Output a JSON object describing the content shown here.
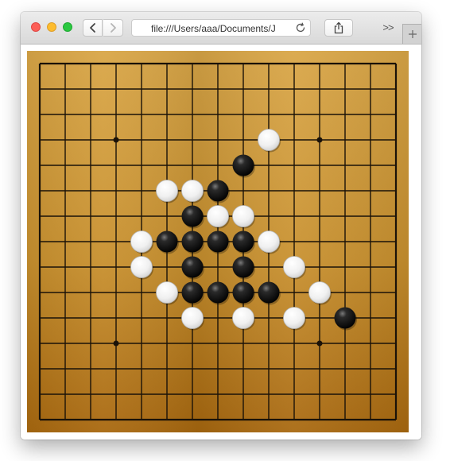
{
  "browser": {
    "address_text": "file:///Users/aaa/Documents/J",
    "overflow_label": ">>",
    "icons": {
      "back": "chevron-left-icon",
      "forward": "chevron-right-icon",
      "reload": "reload-icon",
      "share": "share-icon",
      "new_tab": "plus-icon"
    }
  },
  "game": {
    "type": "gomoku",
    "board_size": 15,
    "star_points": [
      [
        3,
        3
      ],
      [
        11,
        3
      ],
      [
        3,
        11
      ],
      [
        11,
        11
      ]
    ],
    "colors": {
      "board_light": "#d9a647",
      "board_dark": "#a8680f",
      "grid_line": "#1a1208",
      "black_stone": "#0a0a0a",
      "white_stone": "#f2f2f2"
    },
    "stones": [
      {
        "col": 9,
        "row": 3,
        "color": "white"
      },
      {
        "col": 8,
        "row": 4,
        "color": "black"
      },
      {
        "col": 5,
        "row": 5,
        "color": "white"
      },
      {
        "col": 6,
        "row": 5,
        "color": "white"
      },
      {
        "col": 7,
        "row": 5,
        "color": "black"
      },
      {
        "col": 6,
        "row": 6,
        "color": "black"
      },
      {
        "col": 7,
        "row": 6,
        "color": "white"
      },
      {
        "col": 8,
        "row": 6,
        "color": "white"
      },
      {
        "col": 4,
        "row": 7,
        "color": "white"
      },
      {
        "col": 5,
        "row": 7,
        "color": "black"
      },
      {
        "col": 6,
        "row": 7,
        "color": "black"
      },
      {
        "col": 7,
        "row": 7,
        "color": "black"
      },
      {
        "col": 8,
        "row": 7,
        "color": "black"
      },
      {
        "col": 9,
        "row": 7,
        "color": "white"
      },
      {
        "col": 4,
        "row": 8,
        "color": "white"
      },
      {
        "col": 6,
        "row": 8,
        "color": "black"
      },
      {
        "col": 8,
        "row": 8,
        "color": "black"
      },
      {
        "col": 10,
        "row": 8,
        "color": "white"
      },
      {
        "col": 5,
        "row": 9,
        "color": "white"
      },
      {
        "col": 6,
        "row": 9,
        "color": "black"
      },
      {
        "col": 7,
        "row": 9,
        "color": "black"
      },
      {
        "col": 8,
        "row": 9,
        "color": "black"
      },
      {
        "col": 9,
        "row": 9,
        "color": "black"
      },
      {
        "col": 11,
        "row": 9,
        "color": "white"
      },
      {
        "col": 6,
        "row": 10,
        "color": "white"
      },
      {
        "col": 8,
        "row": 10,
        "color": "white"
      },
      {
        "col": 10,
        "row": 10,
        "color": "white"
      },
      {
        "col": 12,
        "row": 10,
        "color": "black"
      }
    ]
  }
}
